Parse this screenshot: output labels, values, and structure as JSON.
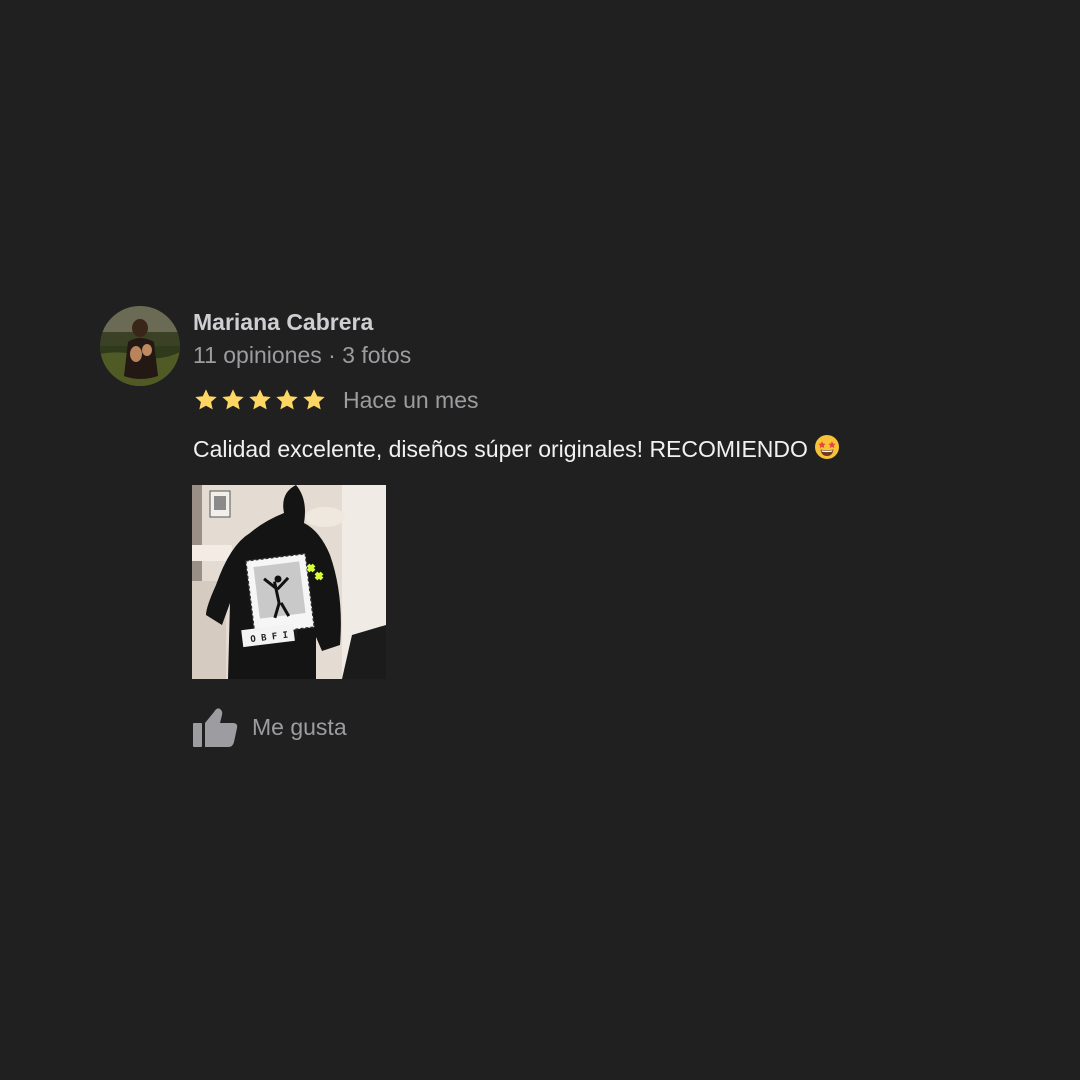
{
  "review": {
    "author_name": "Mariana Cabrera",
    "author_meta": "11 opiniones · 3 fotos",
    "rating": 5,
    "rating_max": 5,
    "time_ago": "Hace un mes",
    "text": "Calidad excelente, diseños súper originales! RECOMIENDO",
    "emoji": "star-struck-emoji",
    "like_label": "Me gusta",
    "icons": {
      "star": "star-icon",
      "like": "thumbs-up-icon"
    }
  },
  "colors": {
    "background": "#202020",
    "star": "#fdd663",
    "name": "#cfcfd3",
    "secondary": "#9d9da1",
    "text": "#f1f1f1"
  }
}
